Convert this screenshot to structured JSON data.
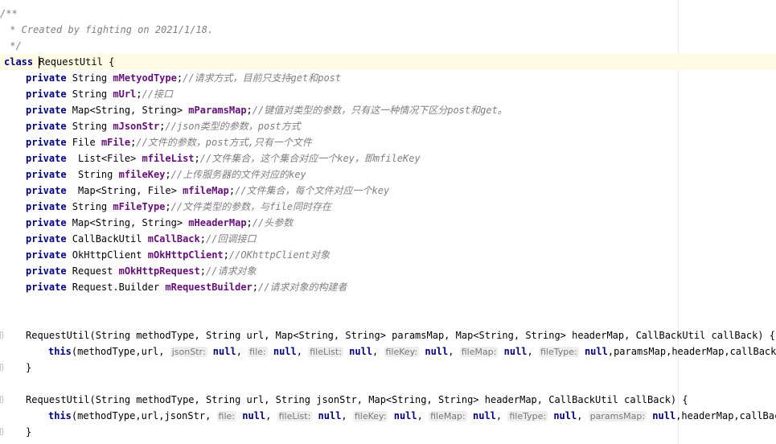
{
  "doc_comment": {
    "open": "/**",
    "created": " * Created by fighting on 2021/1/18.",
    "close": " */"
  },
  "class_decl": {
    "keyword": "class",
    "name": "RequestUtil",
    "brace": " {"
  },
  "fields": [
    {
      "mod": "private",
      "type": " String ",
      "name": "mMetyodType",
      "semi": ";",
      "comment": "//请求方式，目前只支持get和post"
    },
    {
      "mod": "private",
      "type": " String ",
      "name": "mUrl",
      "semi": ";",
      "comment": "//接口"
    },
    {
      "mod": "private",
      "type": " Map<String, String> ",
      "name": "mParamsMap",
      "semi": ";",
      "comment": "//键值对类型的参数，只有这一种情况下区分post和get。"
    },
    {
      "mod": "private",
      "type": " String ",
      "name": "mJsonStr",
      "semi": ";",
      "comment": "//json类型的参数，post方式"
    },
    {
      "mod": "private",
      "type": " File ",
      "name": "mFile",
      "semi": ";",
      "comment": "//文件的参数，post方式,只有一个文件"
    },
    {
      "mod": "private",
      "type": "  List<File> ",
      "name": "mfileList",
      "semi": ";",
      "comment": "//文件集合，这个集合对应一个key，即mfileKey"
    },
    {
      "mod": "private",
      "type": "  String ",
      "name": "mfileKey",
      "semi": ";",
      "comment": "//上传服务器的文件对应的key"
    },
    {
      "mod": "private",
      "type": "  Map<String, File> ",
      "name": "mfileMap",
      "semi": ";",
      "comment": "//文件集合，每个文件对应一个key"
    },
    {
      "mod": "private",
      "type": " String ",
      "name": "mFileType",
      "semi": ";",
      "comment": "//文件类型的参数，与file同时存在"
    },
    {
      "mod": "private",
      "type": " Map<String, String> ",
      "name": "mHeaderMap",
      "semi": ";",
      "comment": "//头参数"
    },
    {
      "mod": "private",
      "type": " CallBackUtil ",
      "name": "mCallBack",
      "semi": ";",
      "comment": "//回调接口"
    },
    {
      "mod": "private",
      "type": " OkHttpClient ",
      "name": "mOkHttpClient",
      "semi": ";",
      "comment": "//OKhttpClient对象"
    },
    {
      "mod": "private",
      "type": " Request ",
      "name": "mOkHttpRequest",
      "semi": ";",
      "comment": "//请求对象"
    },
    {
      "mod": "private",
      "type": " Request.Builder ",
      "name": "mRequestBuilder",
      "semi": ";",
      "comment": "//请求对象的构建者"
    }
  ],
  "ctor1": {
    "signature": "RequestUtil(String methodType, String url, Map<String, String> paramsMap, Map<String, String> headerMap, CallBackUtil callBack) {",
    "this_kw": "this",
    "args_start": "(methodType,url, ",
    "hints": [
      {
        "label": "jsonStr:",
        "value": "null"
      },
      {
        "label": "file:",
        "value": "null"
      },
      {
        "label": "fileList:",
        "value": "null"
      },
      {
        "label": "fileKey:",
        "value": "null"
      },
      {
        "label": "fileMap:",
        "value": "null"
      },
      {
        "label": "fileType:",
        "value": "null"
      }
    ],
    "args_end": ",paramsMap,headerMap,callBack);",
    "close": "}"
  },
  "ctor2": {
    "signature": "RequestUtil(String methodType, String url, String jsonStr, Map<String, String> headerMap, CallBackUtil callBack) {",
    "this_kw": "this",
    "args_start": "(methodType,url,jsonStr, ",
    "hints": [
      {
        "label": "file:",
        "value": "null"
      },
      {
        "label": "fileList:",
        "value": "null"
      },
      {
        "label": "fileKey:",
        "value": "null"
      },
      {
        "label": "fileMap:",
        "value": "null"
      },
      {
        "label": "fileType:",
        "value": "null"
      },
      {
        "label": "paramsMap:",
        "value": "null"
      }
    ],
    "args_end": ",headerMap,callBack);",
    "close": "}"
  },
  "colors": {
    "keyword": "#000080",
    "field": "#660e7a",
    "comment": "#808080",
    "caret_line": "#fffae3"
  }
}
